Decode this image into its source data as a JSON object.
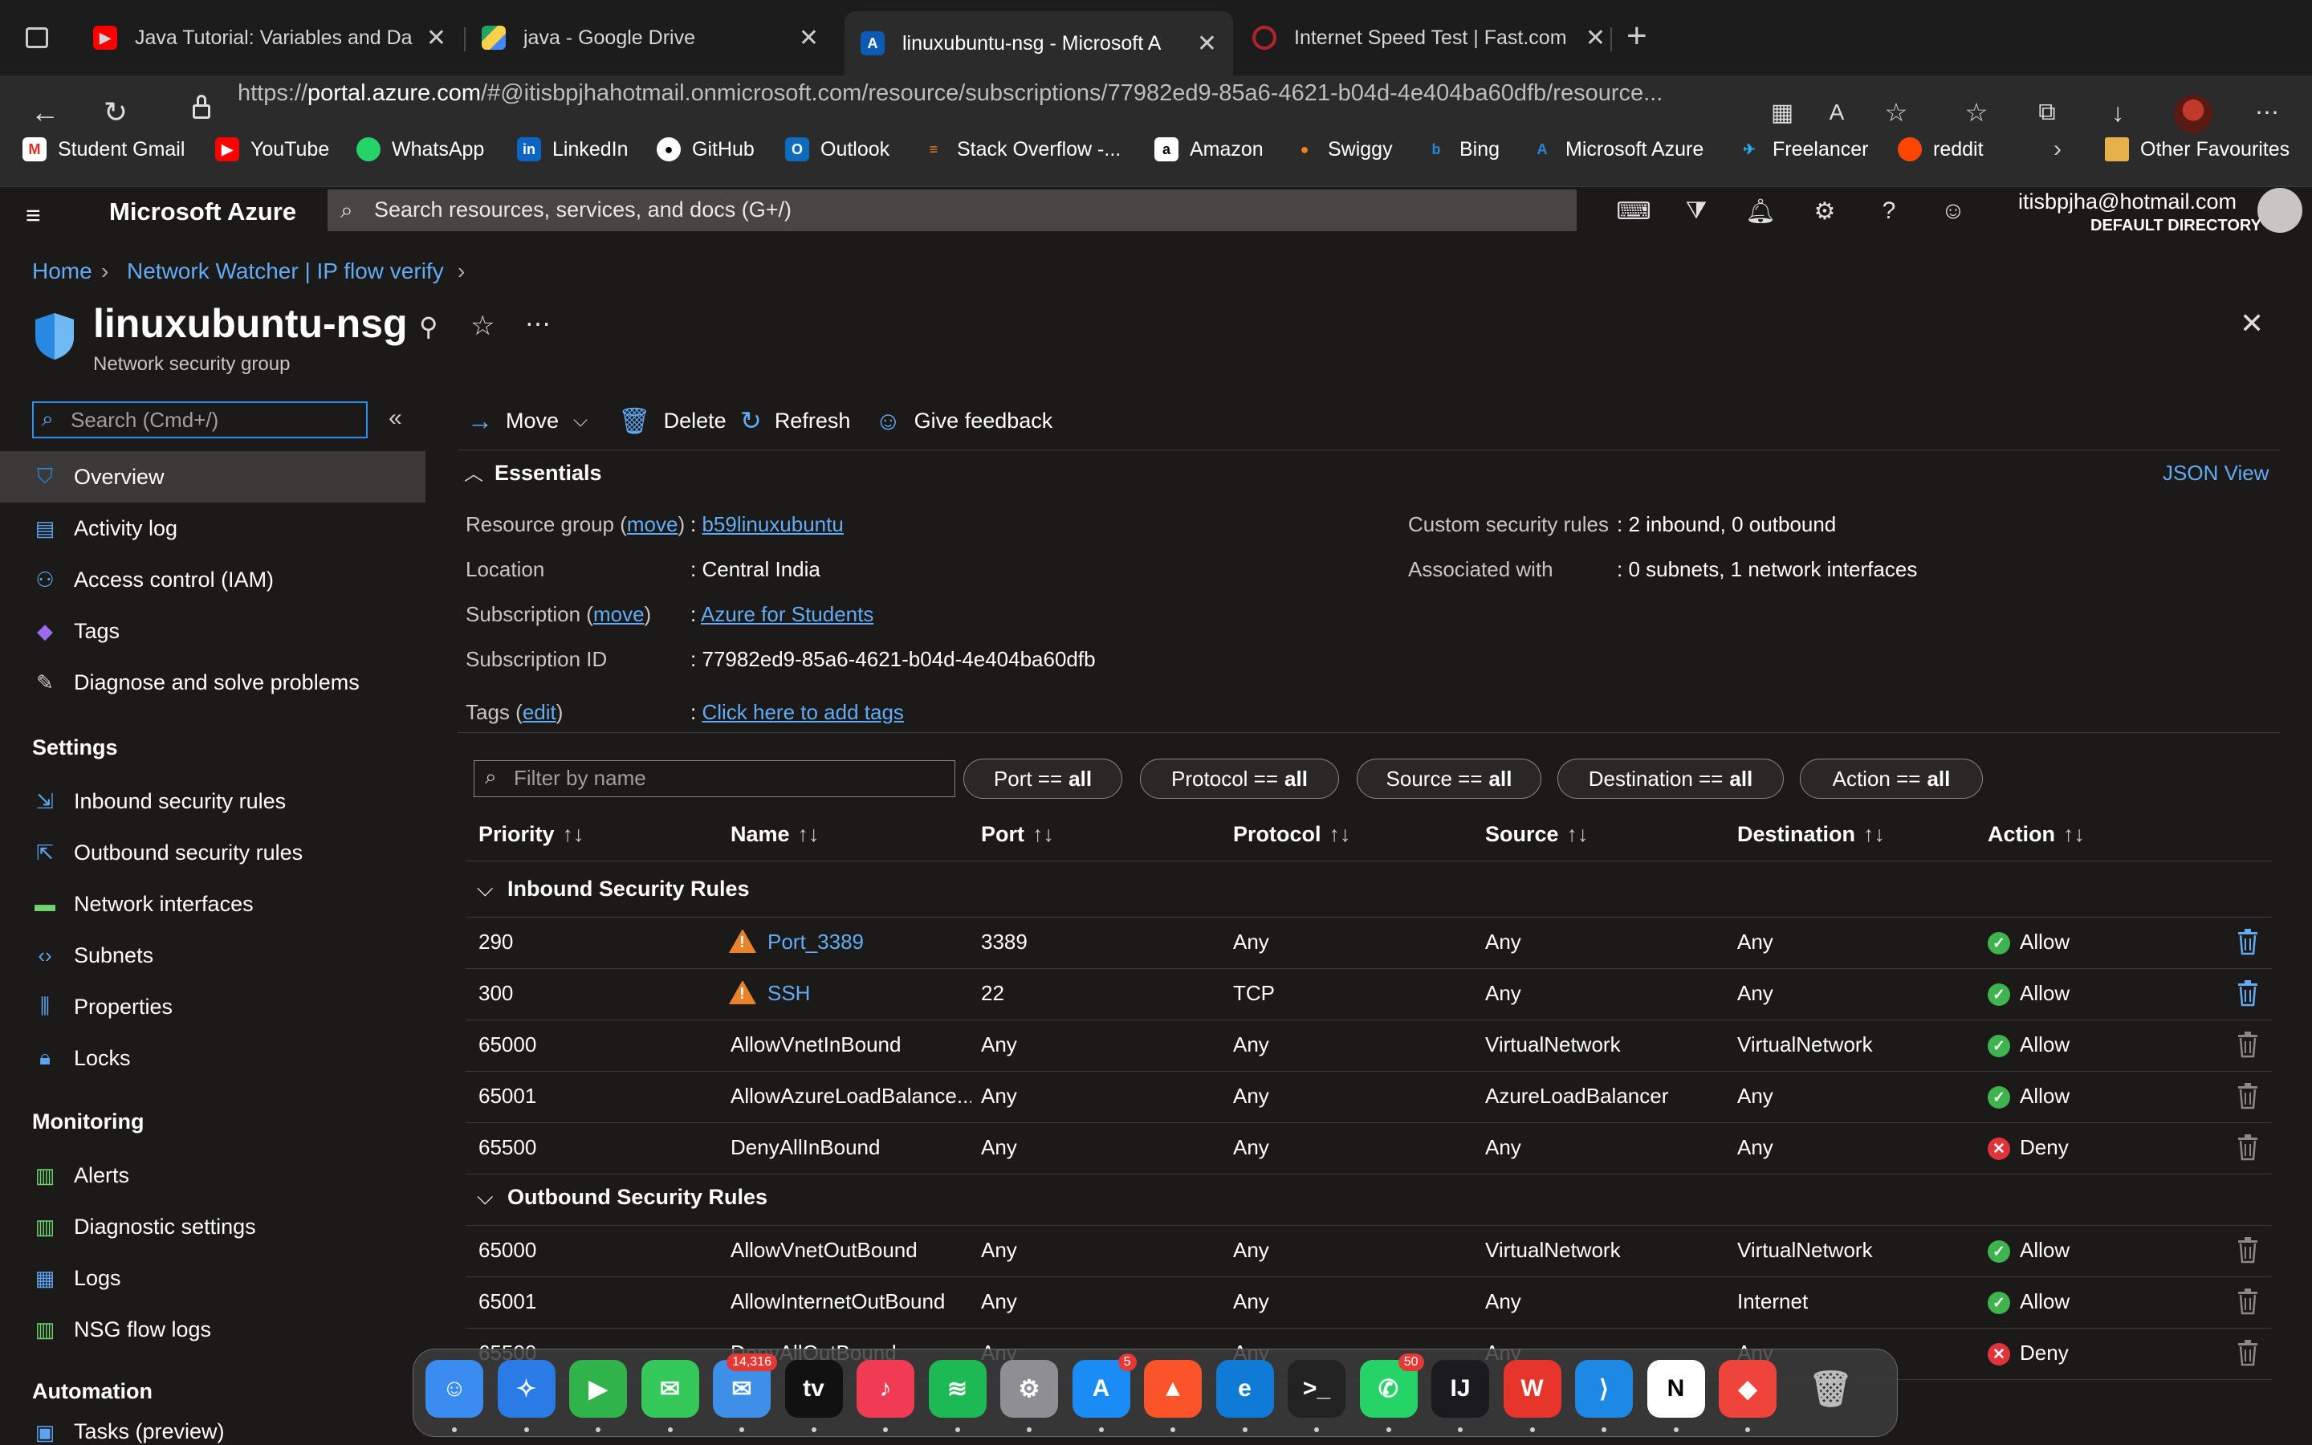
{
  "browser": {
    "tabs": [
      {
        "title": "Java Tutorial: Variables and Da",
        "favicon": "youtube-icon"
      },
      {
        "title": "java - Google Drive",
        "favicon": "google-drive-icon"
      },
      {
        "title": "linuxubuntu-nsg - Microsoft A",
        "favicon": "azure-icon"
      },
      {
        "title": "Internet Speed Test | Fast.com",
        "favicon": "fast-icon"
      }
    ],
    "url_prefix": "https://",
    "url_host": "portal.azure.com",
    "url_rest": "/#@itisbpjhahotmail.onmicrosoft.com/resource/subscriptions/77982ed9-85a6-4621-b04d-4e404ba60dfb/resource...",
    "bookmarks": [
      "Student Gmail",
      "YouTube",
      "WhatsApp",
      "LinkedIn",
      "GitHub",
      "Outlook",
      "Stack Overflow -...",
      "Amazon",
      "Swiggy",
      "Bing",
      "Microsoft Azure",
      "Freelancer",
      "reddit"
    ],
    "other_favourites": "Other Favourites"
  },
  "azure": {
    "brand": "Microsoft Azure",
    "search_placeholder": "Search resources, services, and docs (G+/)",
    "account_email": "itisbpjha@hotmail.com",
    "account_directory": "DEFAULT DIRECTORY"
  },
  "breadcrumb": {
    "home": "Home",
    "parent": "Network Watcher | IP flow verify"
  },
  "resource": {
    "title": "linuxubuntu-nsg",
    "subtitle": "Network security group"
  },
  "sidebar": {
    "search_placeholder": "Search (Cmd+/)",
    "top_items": [
      "Overview",
      "Activity log",
      "Access control (IAM)",
      "Tags",
      "Diagnose and solve problems"
    ],
    "settings_header": "Settings",
    "settings_items": [
      "Inbound security rules",
      "Outbound security rules",
      "Network interfaces",
      "Subnets",
      "Properties",
      "Locks"
    ],
    "monitoring_header": "Monitoring",
    "monitoring_items": [
      "Alerts",
      "Diagnostic settings",
      "Logs",
      "NSG flow logs"
    ],
    "automation_header": "Automation",
    "automation_items": [
      "Tasks (preview)"
    ]
  },
  "commands": {
    "move": "Move",
    "delete": "Delete",
    "refresh": "Refresh",
    "feedback": "Give feedback"
  },
  "essentials": {
    "header": "Essentials",
    "json_view": "JSON View",
    "resource_group_label": "Resource group",
    "move_link": "move",
    "resource_group": "b59linuxubuntu",
    "location_label": "Location",
    "location": "Central India",
    "subscription_label": "Subscription",
    "subscription": "Azure for Students",
    "subscription_id_label": "Subscription ID",
    "subscription_id": "77982ed9-85a6-4621-b04d-4e404ba60dfb",
    "tags_label": "Tags",
    "edit_link": "edit",
    "tags_value": "Click here to add tags",
    "custom_rules_label": "Custom security rules",
    "custom_rules": "2 inbound, 0 outbound",
    "associated_label": "Associated with",
    "associated": "0 subnets, 1 network interfaces"
  },
  "filters": {
    "name_placeholder": "Filter by name",
    "pills": [
      {
        "label": "Port == ",
        "value": "all"
      },
      {
        "label": "Protocol == ",
        "value": "all"
      },
      {
        "label": "Source == ",
        "value": "all"
      },
      {
        "label": "Destination == ",
        "value": "all"
      },
      {
        "label": "Action == ",
        "value": "all"
      }
    ]
  },
  "table": {
    "columns": [
      "Priority",
      "Name",
      "Port",
      "Protocol",
      "Source",
      "Destination",
      "Action"
    ],
    "inbound_header": "Inbound Security Rules",
    "outbound_header": "Outbound Security Rules",
    "inbound": [
      {
        "priority": "290",
        "name": "Port_3389",
        "port": "3389",
        "protocol": "Any",
        "source": "Any",
        "destination": "Any",
        "action": "Allow",
        "warn": true
      },
      {
        "priority": "300",
        "name": "SSH",
        "port": "22",
        "protocol": "TCP",
        "source": "Any",
        "destination": "Any",
        "action": "Allow",
        "warn": true
      },
      {
        "priority": "65000",
        "name": "AllowVnetInBound",
        "port": "Any",
        "protocol": "Any",
        "source": "VirtualNetwork",
        "destination": "VirtualNetwork",
        "action": "Allow",
        "warn": false
      },
      {
        "priority": "65001",
        "name": "AllowAzureLoadBalance...",
        "port": "Any",
        "protocol": "Any",
        "source": "AzureLoadBalancer",
        "destination": "Any",
        "action": "Allow",
        "warn": false
      },
      {
        "priority": "65500",
        "name": "DenyAllInBound",
        "port": "Any",
        "protocol": "Any",
        "source": "Any",
        "destination": "Any",
        "action": "Deny",
        "warn": false
      }
    ],
    "outbound": [
      {
        "priority": "65000",
        "name": "AllowVnetOutBound",
        "port": "Any",
        "protocol": "Any",
        "source": "VirtualNetwork",
        "destination": "VirtualNetwork",
        "action": "Allow",
        "warn": false
      },
      {
        "priority": "65001",
        "name": "AllowInternetOutBound",
        "port": "Any",
        "protocol": "Any",
        "source": "Any",
        "destination": "Internet",
        "action": "Allow",
        "warn": false
      },
      {
        "priority": "65500",
        "name": "DenyAllOutBound",
        "port": "Any",
        "protocol": "Any",
        "source": "Any",
        "destination": "Any",
        "action": "Deny",
        "warn": false
      }
    ]
  },
  "dock": {
    "apps": [
      "finder-icon",
      "safari-icon",
      "facetime-icon",
      "messages-icon",
      "mail-icon",
      "appletv-icon",
      "music-icon",
      "spotify-icon",
      "system-preferences-icon",
      "appstore-icon",
      "brave-icon",
      "edge-icon",
      "terminal-icon",
      "whatsapp-icon",
      "intellij-icon",
      "wps-icon",
      "vscode-icon",
      "notion-icon",
      "anydesk-icon",
      "trash-icon"
    ],
    "mail_badge": "14,316",
    "appstore_badge": "5",
    "whatsapp_badge": "50"
  },
  "colors": {
    "accent": "#62abf5",
    "allow": "#3eb34f",
    "deny": "#e0343b",
    "warn": "#e8832a",
    "bg": "#1b1a19"
  }
}
